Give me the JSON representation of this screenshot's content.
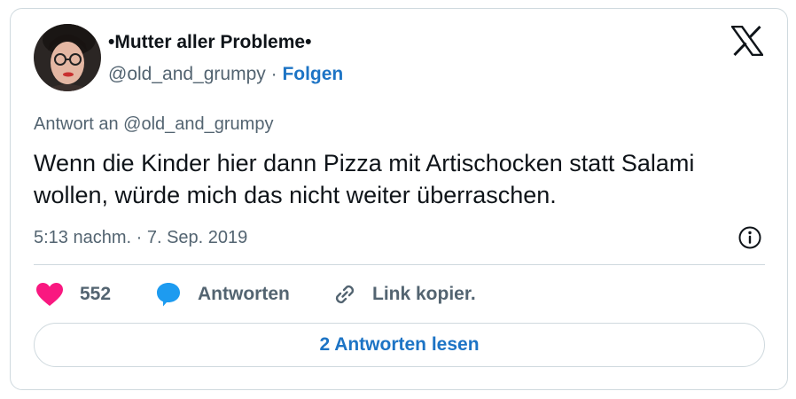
{
  "author": {
    "display_name": "•Mutter aller Probleme•",
    "handle": "@old_and_grumpy",
    "separator": " · ",
    "follow_label": "Folgen"
  },
  "tweet": {
    "reply_to": "Antwort an @old_and_grumpy",
    "text": "Wenn die Kinder hier dann Pizza mit Artischocken statt Salami wollen, würde mich das nicht weiter überraschen.",
    "timestamp": "5:13 nachm. · 7. Sep. 2019"
  },
  "actions": {
    "like_count": "552",
    "reply_label": "Antworten",
    "copy_link_label": "Link kopier."
  },
  "read_replies_label": "2 Antworten lesen",
  "icons": {
    "logo": "x-logo-icon",
    "info": "info-icon",
    "like": "heart-icon",
    "reply": "speech-bubble-icon",
    "link": "link-icon"
  },
  "colors": {
    "like": "#f91880",
    "reply": "#1d9bf0",
    "link_accent": "#1d74c5",
    "muted": "#536471",
    "border": "#cfd9de"
  }
}
